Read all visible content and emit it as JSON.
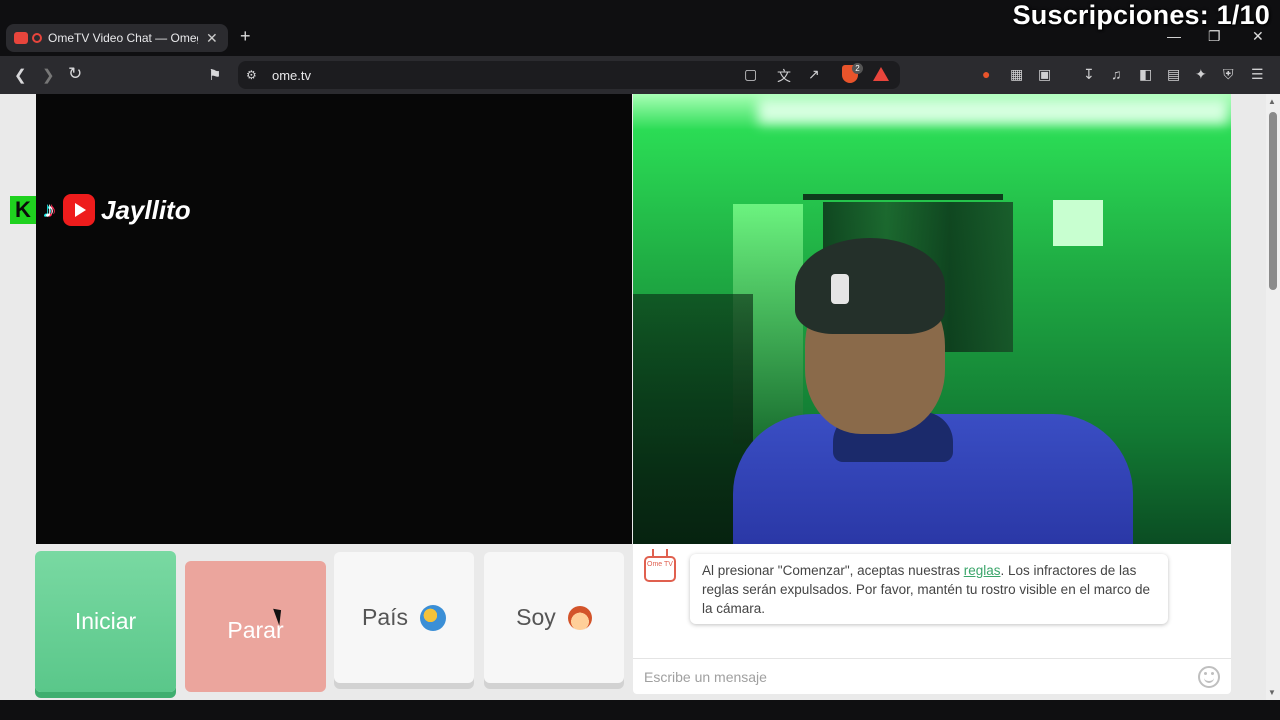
{
  "browser": {
    "tab": {
      "title": "OmeTV Video Chat — Omegl",
      "close": "✕"
    },
    "new_tab": "+",
    "window_controls": {
      "minimize": "—",
      "restore": "❐",
      "close": "✕"
    },
    "url": "ome.tv",
    "brave_badge_count": "2",
    "icons": [
      "back-icon",
      "forward-icon",
      "reload-icon",
      "bookmark-icon",
      "site-settings-icon",
      "cast-icon",
      "translate-icon",
      "share-icon",
      "brave-shields-icon",
      "brave-rewards-icon",
      "extension-fire-icon",
      "extensions-icon",
      "screenshot-icon",
      "downloads-icon",
      "media-icon",
      "sidebar-icon",
      "wallet-icon",
      "leo-ai-icon",
      "vpn-icon",
      "menu-icon"
    ]
  },
  "stream_overlay": {
    "subscriptions": "Suscripciones: 1/10",
    "left_badge": "K",
    "channel_name": "Jayllito"
  },
  "controls": {
    "start": "Iniciar",
    "stop": "Parar",
    "country": "País",
    "gender": "Soy"
  },
  "chat": {
    "logo_text": "Ome TV",
    "notice_before_link": "Al presionar \"Comenzar\", aceptas nuestras ",
    "rules_link": "reglas",
    "notice_after_link": ". Los infractores de las reglas serán expulsados. Por favor, mantén tu rostro visible en el marco de la cámara.",
    "input_placeholder": "Escribe un mensaje"
  },
  "colors": {
    "start_button": "#5ac78a",
    "stop_button": "#eba59d",
    "link": "#3aa56a",
    "ome_logo": "#e0604f"
  }
}
